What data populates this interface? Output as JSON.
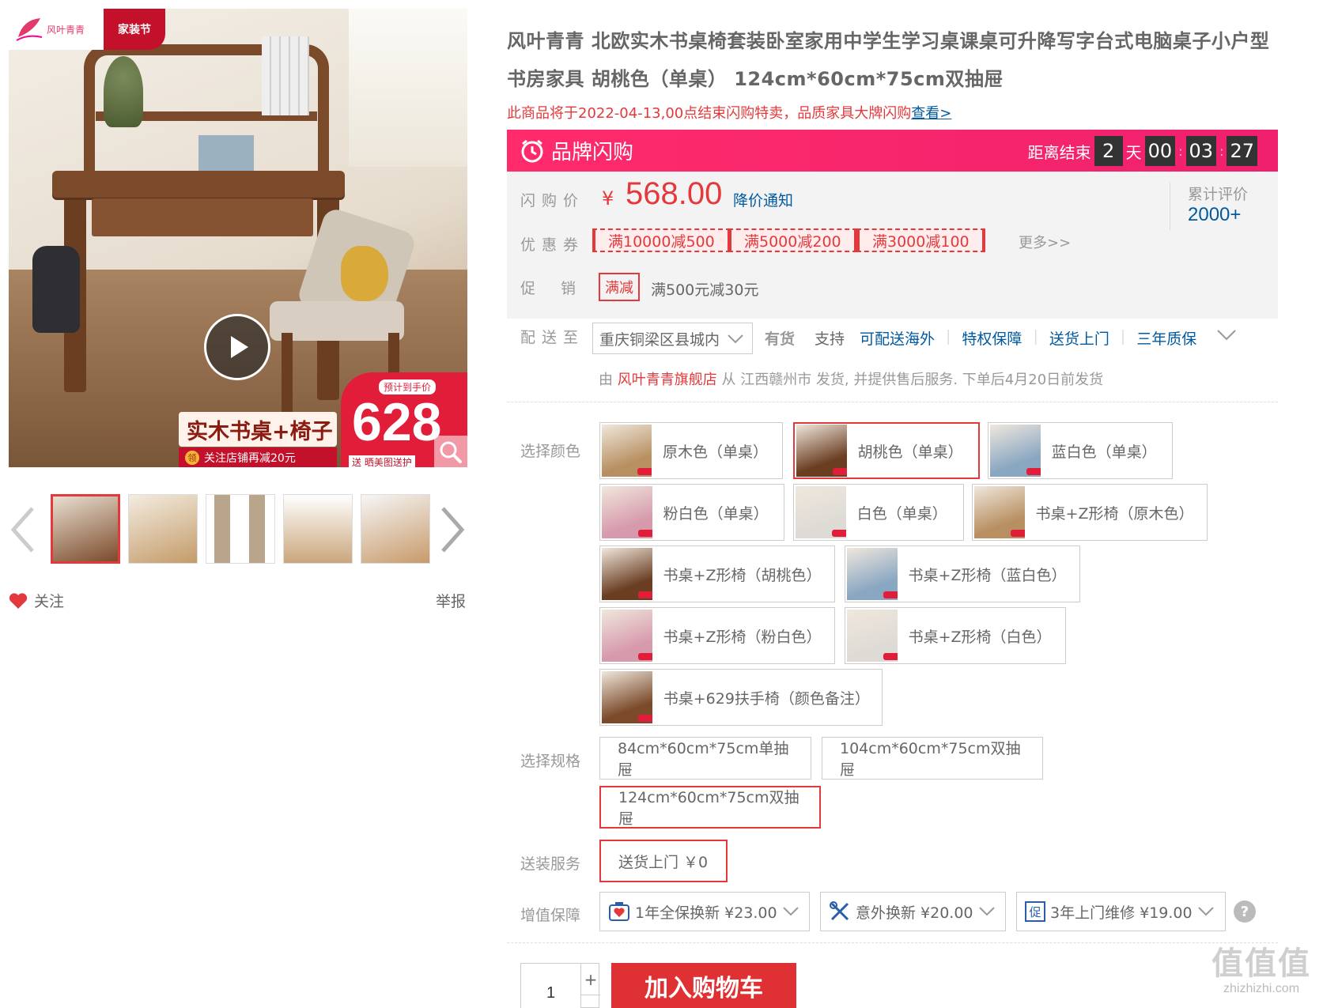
{
  "gallery": {
    "logo_text": "风叶青青",
    "festival_badge": "家装节",
    "promo_title": "实木书桌+椅子",
    "promo_sub": "关注店铺再减20元",
    "coupon_glyph": "领",
    "price_label": "预计到手价",
    "price_big": "628",
    "price_mini": "送 晒美图送护",
    "thumbs": [
      "thumb-walnut",
      "thumb-natural",
      "thumb-variants",
      "thumb-sets",
      "thumb-chair"
    ],
    "follow_label": "关注",
    "report_label": "举报"
  },
  "product": {
    "title": "风叶青青 北欧实木书桌椅套装卧室家用中学生学习桌课桌可升降写字台式电脑桌子小户型书房家具 胡桃色（单桌） 124cm*60cm*75cm双抽屉",
    "notice": "此商品将于2022-04-13,00点结束闪购特卖，品质家具大牌闪购",
    "notice_link": "查看>"
  },
  "flash": {
    "label": "品牌闪购",
    "end_label": "距离结束",
    "days": "2",
    "day_unit": "天",
    "hours": "00",
    "minutes": "03",
    "seconds": "27"
  },
  "pricing": {
    "price_label": "闪购价",
    "currency": "¥",
    "price": "568.00",
    "notify": "降价通知",
    "review_label": "累计评价",
    "review_count": "2000+",
    "coupon_label": "优惠券",
    "coupons": [
      "满10000减500",
      "满5000减200",
      "满3000减100"
    ],
    "more_coupons": "更多>>",
    "promo_label": "促销",
    "promo_tag": "满减",
    "promo_text": "满500元减30元"
  },
  "delivery": {
    "label": "配送至",
    "region": "重庆铜梁区县城内",
    "stock": "有货",
    "support_label": "支持",
    "services": [
      "可配送海外",
      "特权保障",
      "送货上门",
      "三年质保"
    ],
    "ship_prefix": "由",
    "shop_name": "风叶青青旗舰店",
    "ship_suffix": "从 江西赣州市 发货, 并提供售后服务. 下单后4月20日前发货"
  },
  "options": {
    "color_label": "选择颜色",
    "colors": [
      {
        "label": "原木色（单桌）",
        "swatch": "#b88f61"
      },
      {
        "label": "胡桃色（单桌）",
        "swatch": "#6b3e22"
      },
      {
        "label": "蓝白色（单桌）",
        "swatch": "#8aa7c2"
      },
      {
        "label": "粉白色（单桌）",
        "swatch": "#d79aad"
      },
      {
        "label": "白色（单桌）",
        "swatch": "#dedbd6"
      },
      {
        "label": "书桌+Z形椅（原木色）",
        "swatch": "#b88f61"
      },
      {
        "label": "书桌+Z形椅（胡桃色）",
        "swatch": "#6b3e22"
      },
      {
        "label": "书桌+Z形椅（蓝白色）",
        "swatch": "#8aa7c2"
      },
      {
        "label": "书桌+Z形椅（粉白色）",
        "swatch": "#d79aad"
      },
      {
        "label": "书桌+Z形椅（白色）",
        "swatch": "#dedbd6"
      },
      {
        "label": "书桌+629扶手椅（颜色备注）",
        "swatch": "#7b4a2a"
      }
    ],
    "selected_color": "胡桃色（单桌）",
    "spec_label": "选择规格",
    "specs": [
      "84cm*60cm*75cm单抽屉",
      "104cm*60cm*75cm双抽屉",
      "124cm*60cm*75cm双抽屉"
    ],
    "selected_spec": "124cm*60cm*75cm双抽屉",
    "install_label": "送装服务",
    "install_option": "送货上门 ￥0",
    "warranty_label": "增值保障",
    "warranties": [
      "1年全保换新 ¥23.00",
      "意外换新 ¥20.00",
      "3年上门维修 ¥19.00"
    ],
    "warranty_icons": [
      "heart-shield-icon",
      "tools-icon",
      "repair-badge-icon"
    ],
    "warranty_badge_glyph": "促"
  },
  "cart": {
    "quantity": "1",
    "plus": "+",
    "add_label": "加入购物车"
  },
  "watermark": {
    "glyphs": "值值值",
    "url": "zhizhizhi.com"
  },
  "colors": {
    "accent_red": "#e4393c",
    "flash_pink": "#f0206e",
    "link_blue": "#005aa0"
  }
}
